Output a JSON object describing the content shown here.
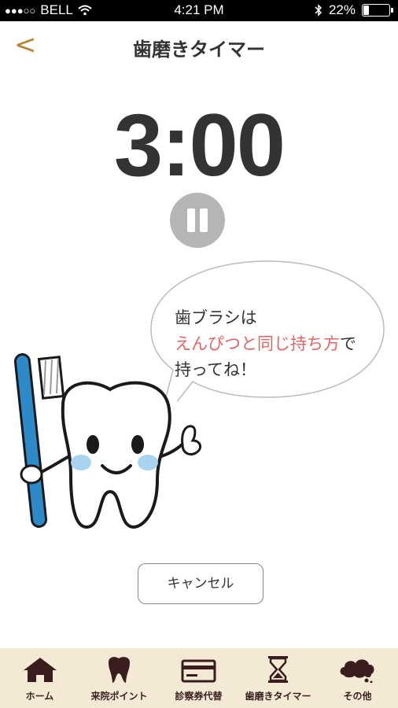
{
  "status": {
    "carrier": "BELL",
    "time": "4:21 PM",
    "battery": "22%",
    "battery_level": 0.22
  },
  "nav": {
    "back": "<",
    "title": "歯磨きタイマー"
  },
  "timer": {
    "display": "3:00"
  },
  "speech": {
    "line1": "歯ブラシは",
    "line2_highlight": "えんぴつと同じ持ち方",
    "line2_rest": "で",
    "line3": "持ってね！"
  },
  "cancel_label": "キャンセル",
  "tabs": [
    {
      "label": "ホーム",
      "icon": "home-icon"
    },
    {
      "label": "来院ポイント",
      "icon": "tooth-icon"
    },
    {
      "label": "診察券代替",
      "icon": "card-icon"
    },
    {
      "label": "歯磨きタイマー",
      "icon": "hourglass-icon"
    },
    {
      "label": "その他",
      "icon": "cloud-icon"
    }
  ],
  "colors": {
    "accent": "#b8863b",
    "highlight": "#e36565",
    "tab_bg": "#f3e9d5",
    "tab_icon": "#3a1e1e"
  }
}
